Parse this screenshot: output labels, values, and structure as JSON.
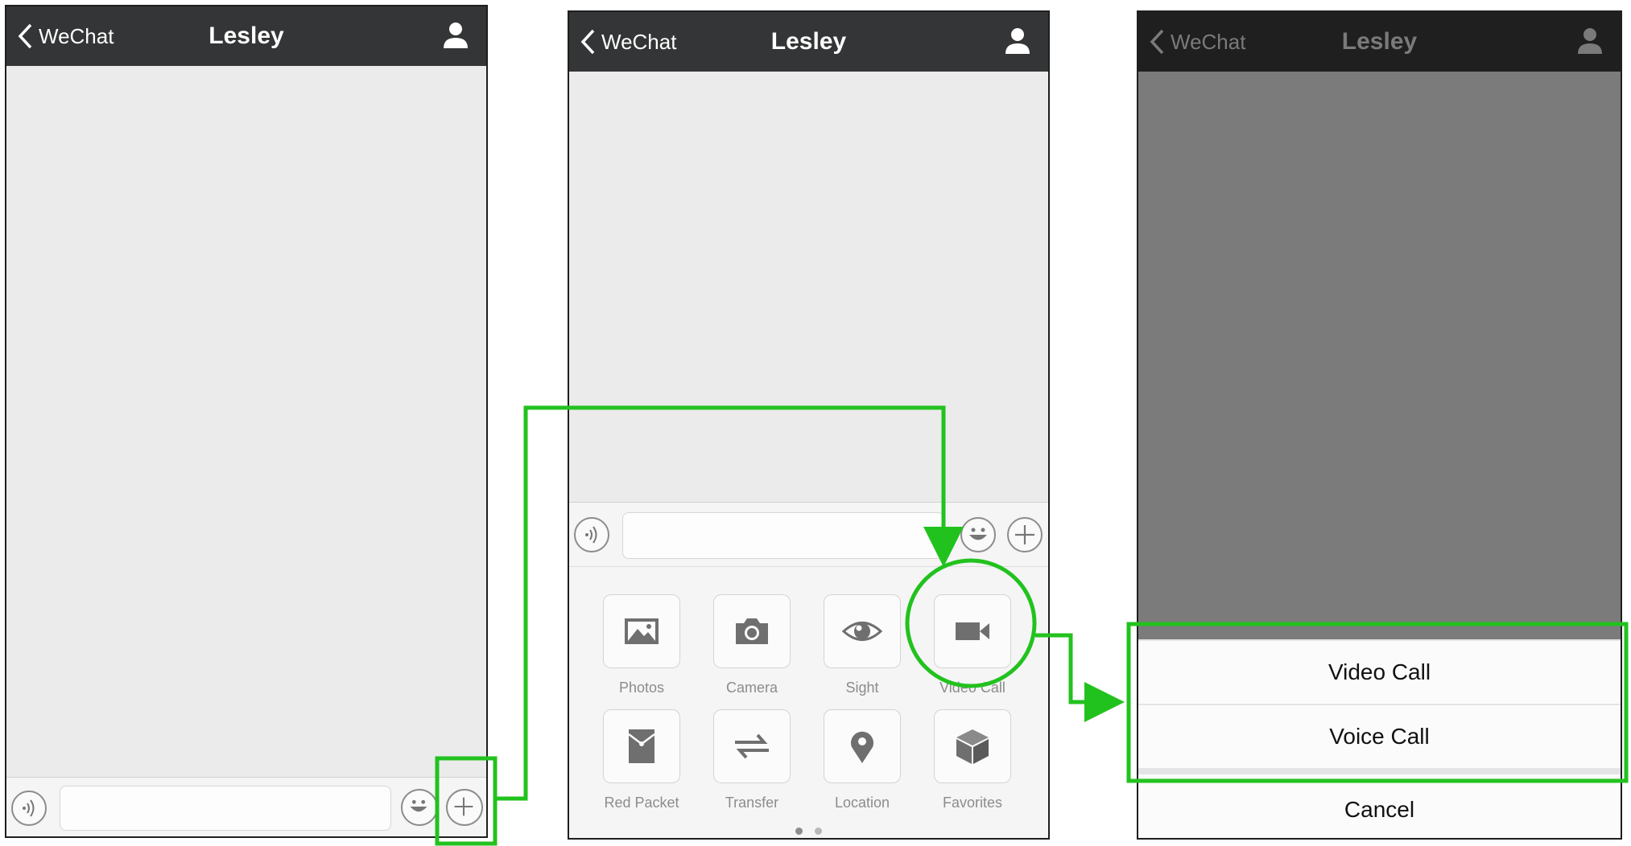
{
  "screens": [
    {
      "nav": {
        "back_label": "WeChat",
        "title": "Lesley"
      }
    },
    {
      "nav": {
        "back_label": "WeChat",
        "title": "Lesley"
      },
      "tools": [
        {
          "label": "Photos",
          "icon": "photos-icon"
        },
        {
          "label": "Camera",
          "icon": "camera-icon"
        },
        {
          "label": "Sight",
          "icon": "sight-icon"
        },
        {
          "label": "Video Call",
          "icon": "video-call-icon"
        },
        {
          "label": "Red Packet",
          "icon": "red-packet-icon"
        },
        {
          "label": "Transfer",
          "icon": "transfer-icon"
        },
        {
          "label": "Location",
          "icon": "location-icon"
        },
        {
          "label": "Favorites",
          "icon": "favorites-icon"
        }
      ]
    },
    {
      "nav": {
        "back_label": "WeChat",
        "title": "Lesley"
      },
      "sheet": {
        "video_call": "Video Call",
        "voice_call": "Voice Call",
        "cancel": "Cancel"
      }
    }
  ],
  "colors": {
    "navbar": "#343536",
    "chat_background": "#ebebeb",
    "annotation_green": "#22c21e",
    "dim_overlay": "#7b7b7b"
  }
}
